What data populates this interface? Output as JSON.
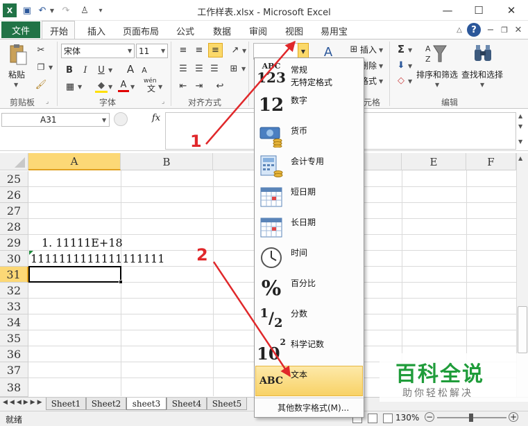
{
  "window": {
    "title": "工作样表.xlsx - Microsoft Excel",
    "min_glyph": "—",
    "max_glyph": "☐",
    "close_glyph": "✕"
  },
  "tabs": {
    "file": "文件",
    "items": [
      "开始",
      "插入",
      "页面布局",
      "公式",
      "数据",
      "审阅",
      "视图",
      "易用宝"
    ]
  },
  "ribbon": {
    "paste_label": "粘贴",
    "font_name": "宋体",
    "font_size": "11",
    "bold": "B",
    "italic": "I",
    "underline": "U",
    "grow_font": "A",
    "shrink_font": "A",
    "font_color": "A",
    "wen": "wén",
    "number_format_value": "",
    "insert_label": "插入",
    "delete_label": "删除",
    "format_label": "格式",
    "sort_filter_label": "排序和筛选",
    "find_select_label": "查找和选择",
    "sigma": "Σ",
    "groups": {
      "clipboard": "剪贴板",
      "font": "字体",
      "alignment": "对齐方式",
      "cells": "元格",
      "editing": "编辑"
    }
  },
  "formula_bar": {
    "name_box": "A31",
    "fx": "fx"
  },
  "grid": {
    "columns": [
      "A",
      "B",
      "E",
      "F"
    ],
    "rows": [
      "25",
      "26",
      "27",
      "28",
      "29",
      "30",
      "31",
      "32",
      "33",
      "34",
      "35",
      "36",
      "37",
      "38"
    ],
    "cells": {
      "a29": "1. 11111E+18",
      "a30": "1111111111111111111"
    },
    "active_row": "31"
  },
  "sheets": [
    "Sheet1",
    "Sheet2",
    "sheet3",
    "Sheet4",
    "Sheet5"
  ],
  "status": {
    "ready": "就绪",
    "zoom": "130%"
  },
  "number_format_menu": {
    "items": [
      {
        "label": "常规",
        "sub": "无特定格式",
        "icon": "general-abc123-icon"
      },
      {
        "label": "数字",
        "icon": "number-12-icon"
      },
      {
        "label": "货币",
        "icon": "currency-icon"
      },
      {
        "label": "会计专用",
        "icon": "accounting-icon"
      },
      {
        "label": "短日期",
        "icon": "short-date-calendar-icon"
      },
      {
        "label": "长日期",
        "icon": "long-date-calendar-icon"
      },
      {
        "label": "时间",
        "icon": "clock-icon"
      },
      {
        "label": "百分比",
        "icon": "percent-icon"
      },
      {
        "label": "分数",
        "icon": "fraction-icon"
      },
      {
        "label": "科学记数",
        "icon": "scientific-icon"
      },
      {
        "label": "文本",
        "icon": "text-abc-icon"
      }
    ],
    "icon_text": {
      "general_top": "ABC",
      "general_bottom": "123",
      "number": "12",
      "percent": "%",
      "fraction_num": "1",
      "fraction_den": "2",
      "sci_base": "10",
      "sci_exp": "2",
      "text": "ABC"
    },
    "more": "其他数字格式(M)..."
  },
  "annotations": {
    "step1": "1",
    "step2": "2"
  },
  "watermark": {
    "title": "百科全说",
    "subtitle": "助你轻松解决"
  },
  "colors": {
    "excel_green": "#217346",
    "arrow_red": "#e0282b",
    "highlight": "#f8d266",
    "watermark_green": "#1f9c3a"
  }
}
